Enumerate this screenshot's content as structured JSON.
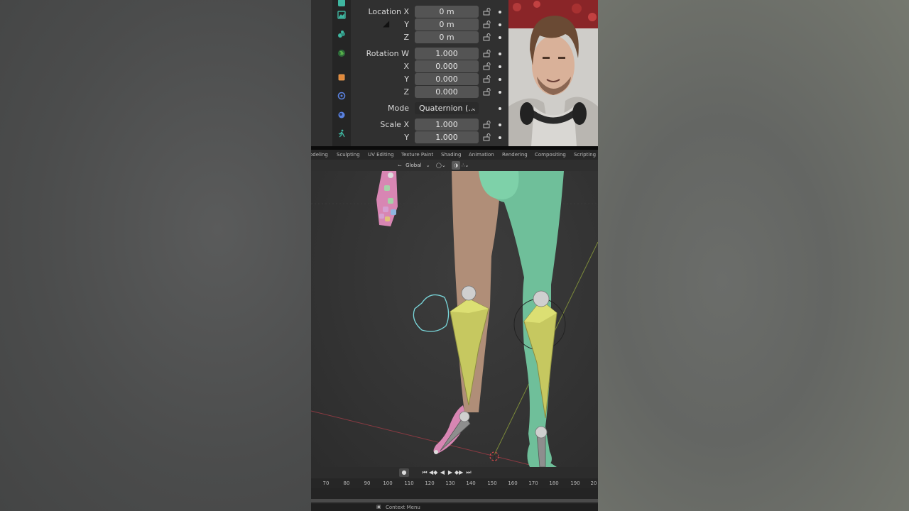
{
  "properties": {
    "rows": [
      {
        "label": "Location X",
        "value": "0 m"
      },
      {
        "label": "Y",
        "value": "0 m"
      },
      {
        "label": "Z",
        "value": "0 m"
      },
      {
        "label": "Rotation W",
        "value": "1.000"
      },
      {
        "label": "X",
        "value": "0.000"
      },
      {
        "label": "Y",
        "value": "0.000"
      },
      {
        "label": "Z",
        "value": "0.000"
      },
      {
        "label": "Mode",
        "value": "Quaternion (..."
      },
      {
        "label": "Scale X",
        "value": "1.000"
      },
      {
        "label": "Y",
        "value": "1.000"
      }
    ],
    "tabs": [
      {
        "icon": "scene-icon",
        "color": "#3fb6a0"
      },
      {
        "icon": "world-icon",
        "color": "#3fb6a0"
      },
      {
        "icon": "globe-icon",
        "color": "#59b04a"
      },
      {
        "icon": "object-icon",
        "color": "#e0883a"
      },
      {
        "icon": "modifier-icon",
        "color": "#5a82e0"
      },
      {
        "icon": "physics-icon",
        "color": "#5a82e0"
      },
      {
        "icon": "armature-pose-icon",
        "color": "#3fb6a0"
      }
    ]
  },
  "workspaces": [
    "odeling",
    "Sculpting",
    "UV Editing",
    "Texture Paint",
    "Shading",
    "Animation",
    "Rendering",
    "Compositing",
    "Scripting"
  ],
  "header": {
    "orientation": "Global",
    "pivot_icon": "pivot-icon",
    "snap_icon": "snap-icon",
    "proportional_icon": "proportional-edit-icon"
  },
  "timeline": {
    "playback_icons": [
      "jump-start-icon",
      "prev-keyframe-icon",
      "play-reverse-icon",
      "play-icon",
      "next-keyframe-icon",
      "jump-end-icon"
    ],
    "ticks": [
      "70",
      "80",
      "90",
      "100",
      "110",
      "120",
      "130",
      "140",
      "150",
      "160",
      "170",
      "180",
      "190",
      "20"
    ]
  },
  "status": {
    "context_menu": "Context Menu"
  },
  "colors": {
    "accent_green": "#3fb6a0",
    "bone_yellow": "#c6c860",
    "mesh_green": "#6fbf9a",
    "mesh_tan": "#b08e78",
    "mesh_pink": "#d886b3"
  }
}
